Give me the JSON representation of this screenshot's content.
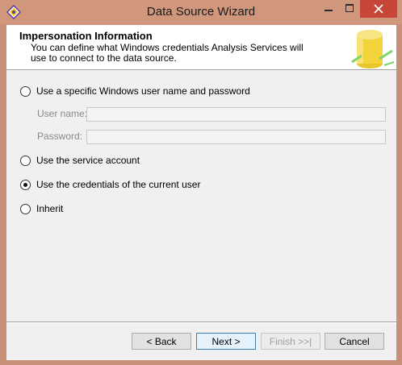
{
  "window": {
    "title": "Data Source Wizard"
  },
  "header": {
    "title": "Impersonation Information",
    "description": "You can define what Windows credentials Analysis Services will use to connect to the data source."
  },
  "options": {
    "specific_user": {
      "label": "Use a specific Windows user name and password",
      "selected": false
    },
    "service_account": {
      "label": "Use the service account",
      "selected": false
    },
    "current_user": {
      "label": "Use the credentials of the current user",
      "selected": true
    },
    "inherit": {
      "label": "Inherit",
      "selected": false
    }
  },
  "fields": {
    "user_name": {
      "label": "User name:",
      "value": ""
    },
    "password": {
      "label": "Password:",
      "value": ""
    }
  },
  "buttons": {
    "back": "< Back",
    "next": "Next >",
    "finish": "Finish >>|",
    "cancel": "Cancel"
  }
}
